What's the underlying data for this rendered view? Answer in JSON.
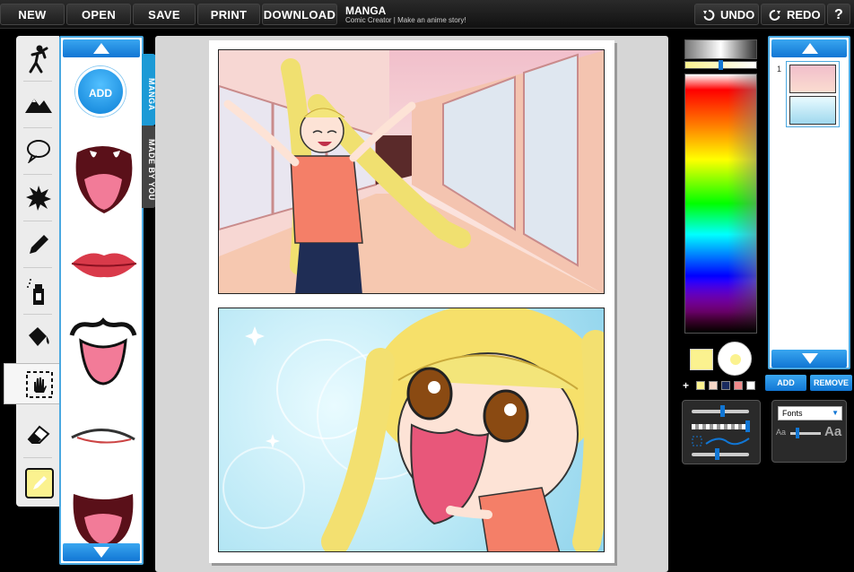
{
  "toolbar": {
    "new_label": "NEW",
    "open_label": "OPEN",
    "save_label": "SAVE",
    "print_label": "PRINT",
    "download_label": "DOWNLOAD",
    "undo_label": "UNDO",
    "redo_label": "REDO",
    "help_label": "?"
  },
  "brand": {
    "title": "MANGA",
    "subtitle": "Comic Creator | Make an anime story!"
  },
  "tools": [
    {
      "name": "character-tool-icon"
    },
    {
      "name": "background-tool-icon"
    },
    {
      "name": "speech-bubble-tool-icon"
    },
    {
      "name": "effects-tool-icon"
    },
    {
      "name": "pencil-tool-icon"
    },
    {
      "name": "spray-tool-icon"
    },
    {
      "name": "fill-bucket-tool-icon"
    },
    {
      "name": "move-hand-tool-icon"
    },
    {
      "name": "eraser-tool-icon"
    },
    {
      "name": "color-tool-icon"
    }
  ],
  "library": {
    "tab_manga": "MANGA",
    "tab_made_by_you": "MADE BY YOU",
    "add_label": "ADD",
    "items": [
      "open-mouth",
      "lips",
      "cat-mouth",
      "smirk-mouth",
      "wide-mouth"
    ]
  },
  "colors": {
    "selected": "#fbf28f",
    "swatches": [
      "#ffffff",
      "#fbf28f",
      "#f6d7c8",
      "#f9b9b0",
      "#1a2b5f",
      "#f08a8a",
      "#ffffff"
    ]
  },
  "thumbnails": {
    "page_number": "1",
    "add_label": "ADD",
    "remove_label": "REMOVE"
  },
  "fonts": {
    "selected": "Fonts",
    "small_a": "Aa",
    "large_a": "Aa"
  }
}
